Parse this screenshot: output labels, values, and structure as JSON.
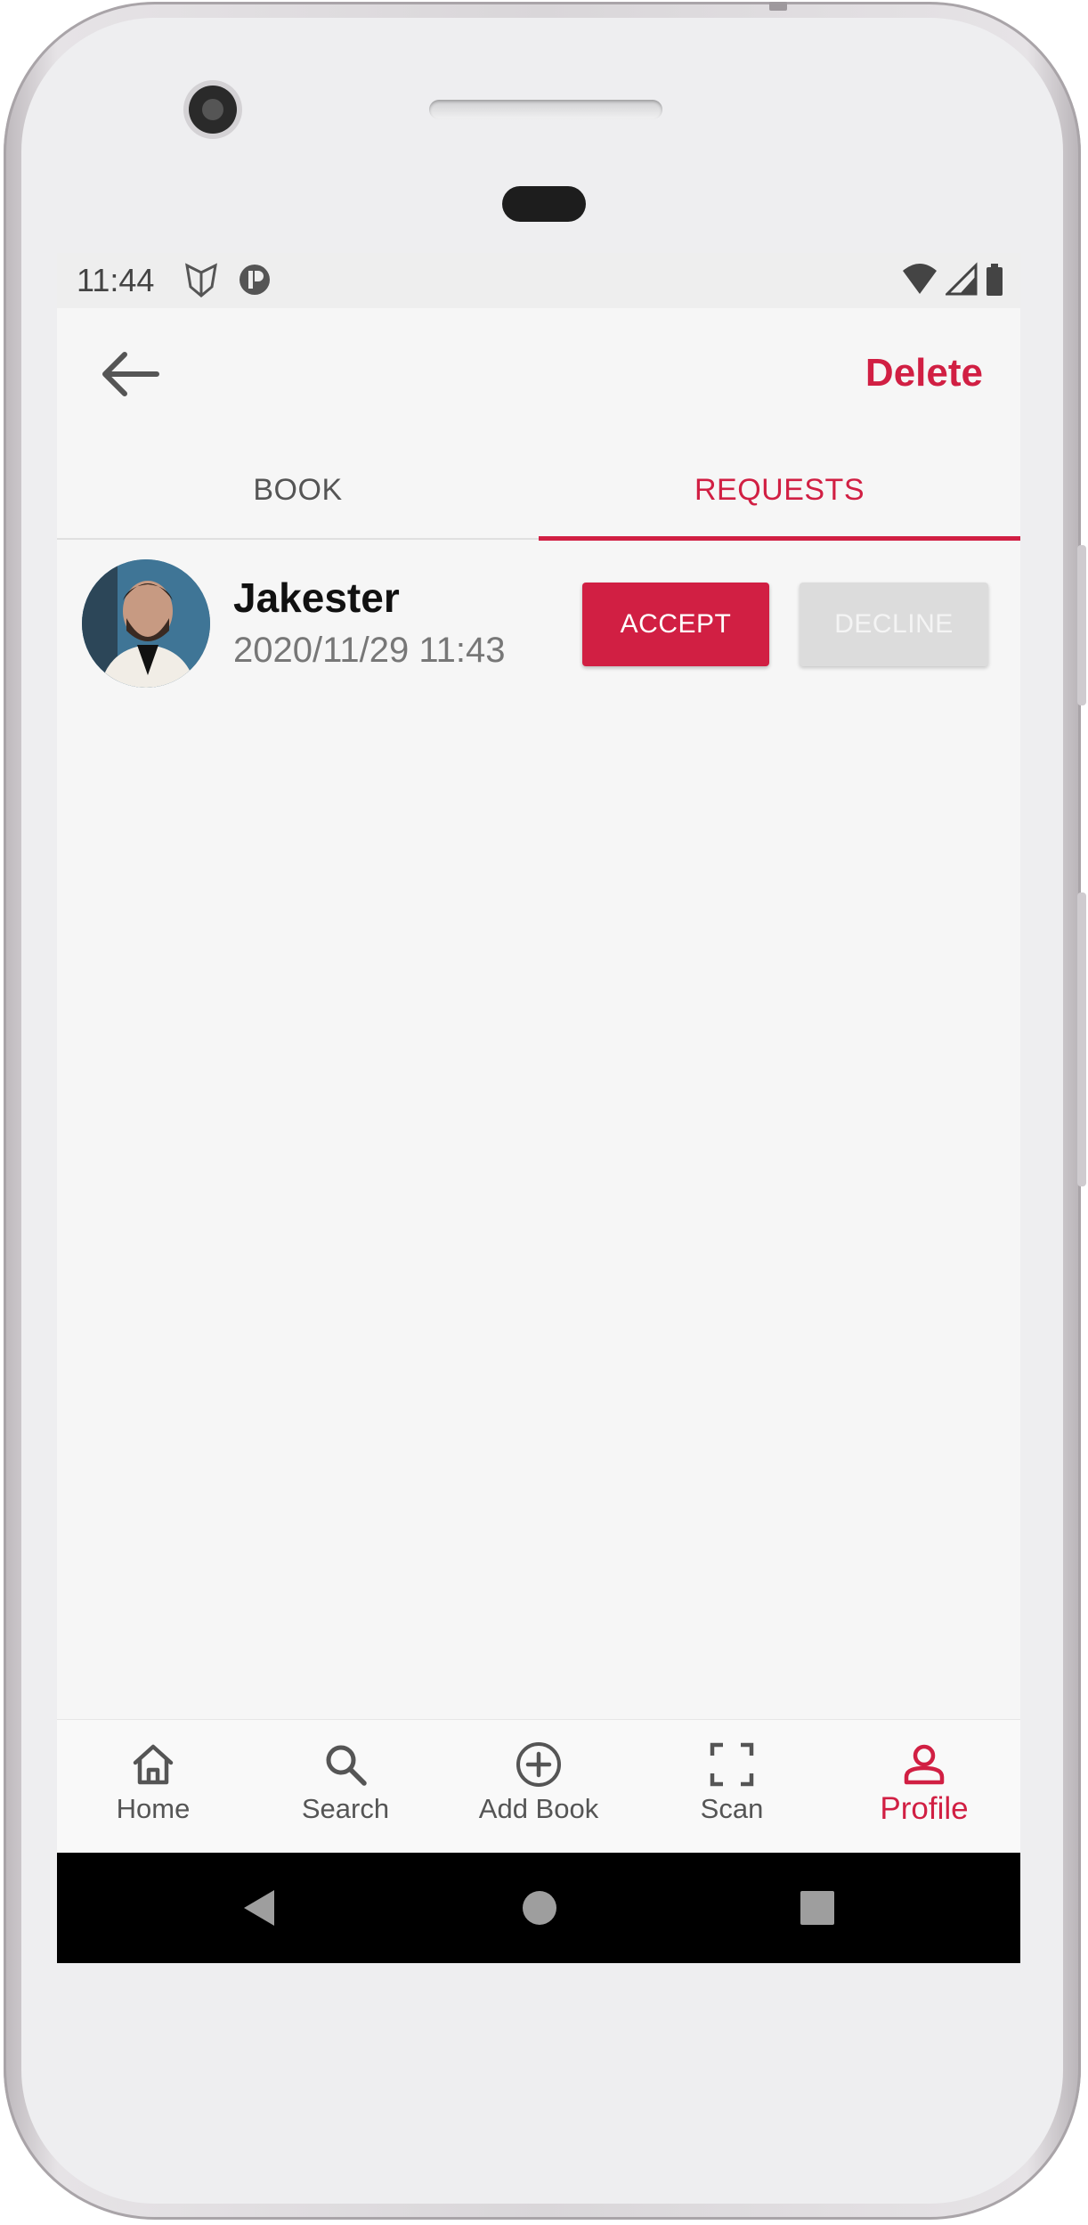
{
  "status_bar": {
    "time": "11:44",
    "left_icons": [
      "shield-app-icon",
      "pi-app-icon"
    ],
    "right_icons": [
      "wifi-icon",
      "signal-icon",
      "battery-icon"
    ]
  },
  "app_bar": {
    "back_icon": "arrow-left-icon",
    "delete_label": "Delete"
  },
  "tabs": [
    {
      "label": "BOOK",
      "selected": false
    },
    {
      "label": "REQUESTS",
      "selected": true
    }
  ],
  "request": {
    "user_name": "Jakester",
    "datetime": "2020/11/29 11:43",
    "accept_label": "ACCEPT",
    "decline_label": "DECLINE"
  },
  "bottom_nav": [
    {
      "label": "Home",
      "icon": "home-icon",
      "active": false
    },
    {
      "label": "Search",
      "icon": "search-icon",
      "active": false
    },
    {
      "label": "Add Book",
      "icon": "add-circle-icon",
      "active": false
    },
    {
      "label": "Scan",
      "icon": "scan-icon",
      "active": false
    },
    {
      "label": "Profile",
      "icon": "profile-icon",
      "active": true
    }
  ],
  "system_nav": [
    "back-triangle-icon",
    "home-circle-icon",
    "recents-square-icon"
  ],
  "colors": {
    "accent": "#d11f43",
    "background": "#f6f6f6",
    "decline_bg": "#dcdcdc",
    "text_muted": "#777777"
  }
}
